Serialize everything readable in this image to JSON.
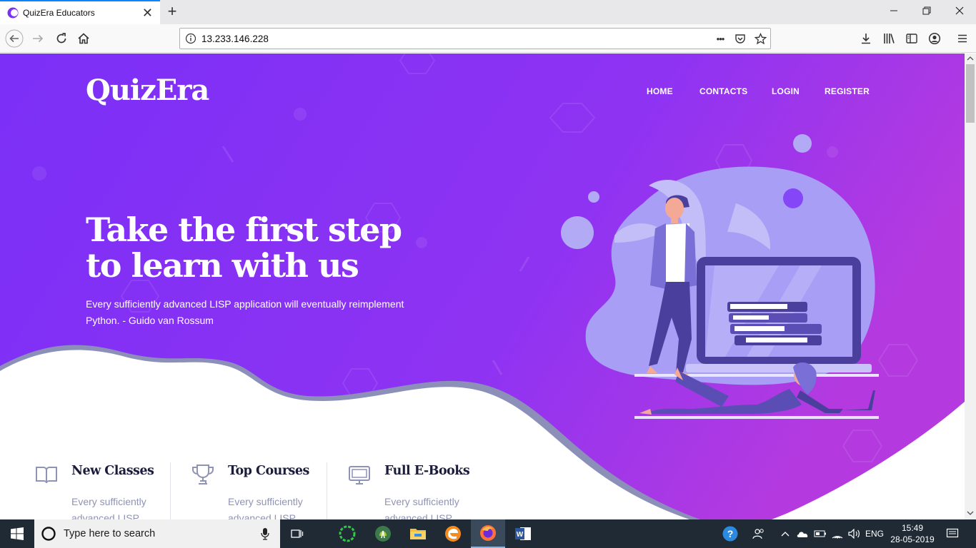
{
  "browser": {
    "tab_title": "QuizEra Educators",
    "new_tab_symbol": "+",
    "url": "13.233.146.228",
    "page_actions_symbol": "•••",
    "window_controls": [
      "minimize-icon",
      "restore-icon",
      "close-icon"
    ],
    "toolbar_icons": [
      "download-icon",
      "library-icon",
      "sidebar-icon",
      "account-icon",
      "hamburger-menu-icon"
    ]
  },
  "site": {
    "logo": "QuizEra",
    "nav": [
      {
        "label": "HOME"
      },
      {
        "label": "CONTACTS"
      },
      {
        "label": "LOGIN"
      },
      {
        "label": "REGISTER"
      }
    ],
    "hero": {
      "title_line1": "Take the first step",
      "title_line2": "to learn with us",
      "quote_line1": "Every sufficiently advanced LISP application will eventually reimplement",
      "quote_line2": "Python. - Guido van Rossum"
    },
    "features": [
      {
        "icon": "book-icon",
        "title": "New Classes",
        "text_line1": "Every sufficiently",
        "text_line2": "advanced LISP"
      },
      {
        "icon": "trophy-icon",
        "title": "Top Courses",
        "text_line1": "Every sufficiently",
        "text_line2": "advanced LISP"
      },
      {
        "icon": "monitor-icon",
        "title": "Full E-Books",
        "text_line1": "Every sufficiently",
        "text_line2": "advanced LISP"
      }
    ],
    "colors": {
      "hero_start": "#7b2ff7",
      "hero_end": "#b13ce0",
      "accent": "#a89ef5"
    }
  },
  "taskbar": {
    "search_placeholder": "Type here to search",
    "language": "ENG",
    "time": "15:49",
    "date": "28-05-2019",
    "apps": [
      "task-view-icon",
      "android-studio-icon",
      "file-explorer-icon",
      "edge-icon",
      "firefox-icon",
      "word-icon"
    ]
  }
}
